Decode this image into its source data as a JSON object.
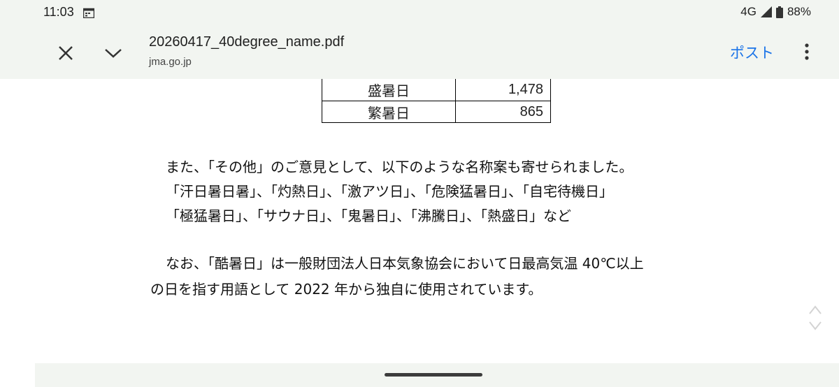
{
  "status_bar": {
    "time": "11:03",
    "network": "4G",
    "battery": "88%"
  },
  "toolbar": {
    "title": "20260417_40degree_name.pdf",
    "domain": "jma.go.jp",
    "post_label": "ポスト"
  },
  "table": {
    "rows": [
      {
        "name": "盛暑日",
        "value": "1,478"
      },
      {
        "name": "繁暑日",
        "value": "865"
      }
    ]
  },
  "body": {
    "line1": "また、「その他」のご意見として、以下のような名称案も寄せられました。",
    "line2": "「汗日暑日暑」、「灼熱日」、「激アツ日」、「危険猛暑日」、「自宅待機日」",
    "line3": "「極猛暑日」、「サウナ日」、「鬼暑日」、「沸騰日」、「熱盛日」など",
    "line4": "なお、「酷暑日」は一般財団法人日本気象協会において日最高気温 40℃以上",
    "line5": "の日を指す用語として 2022 年から独自に使用されています。"
  },
  "colors": {
    "chrome_bg": "#f2f5f1",
    "accent": "#1a73e8"
  }
}
